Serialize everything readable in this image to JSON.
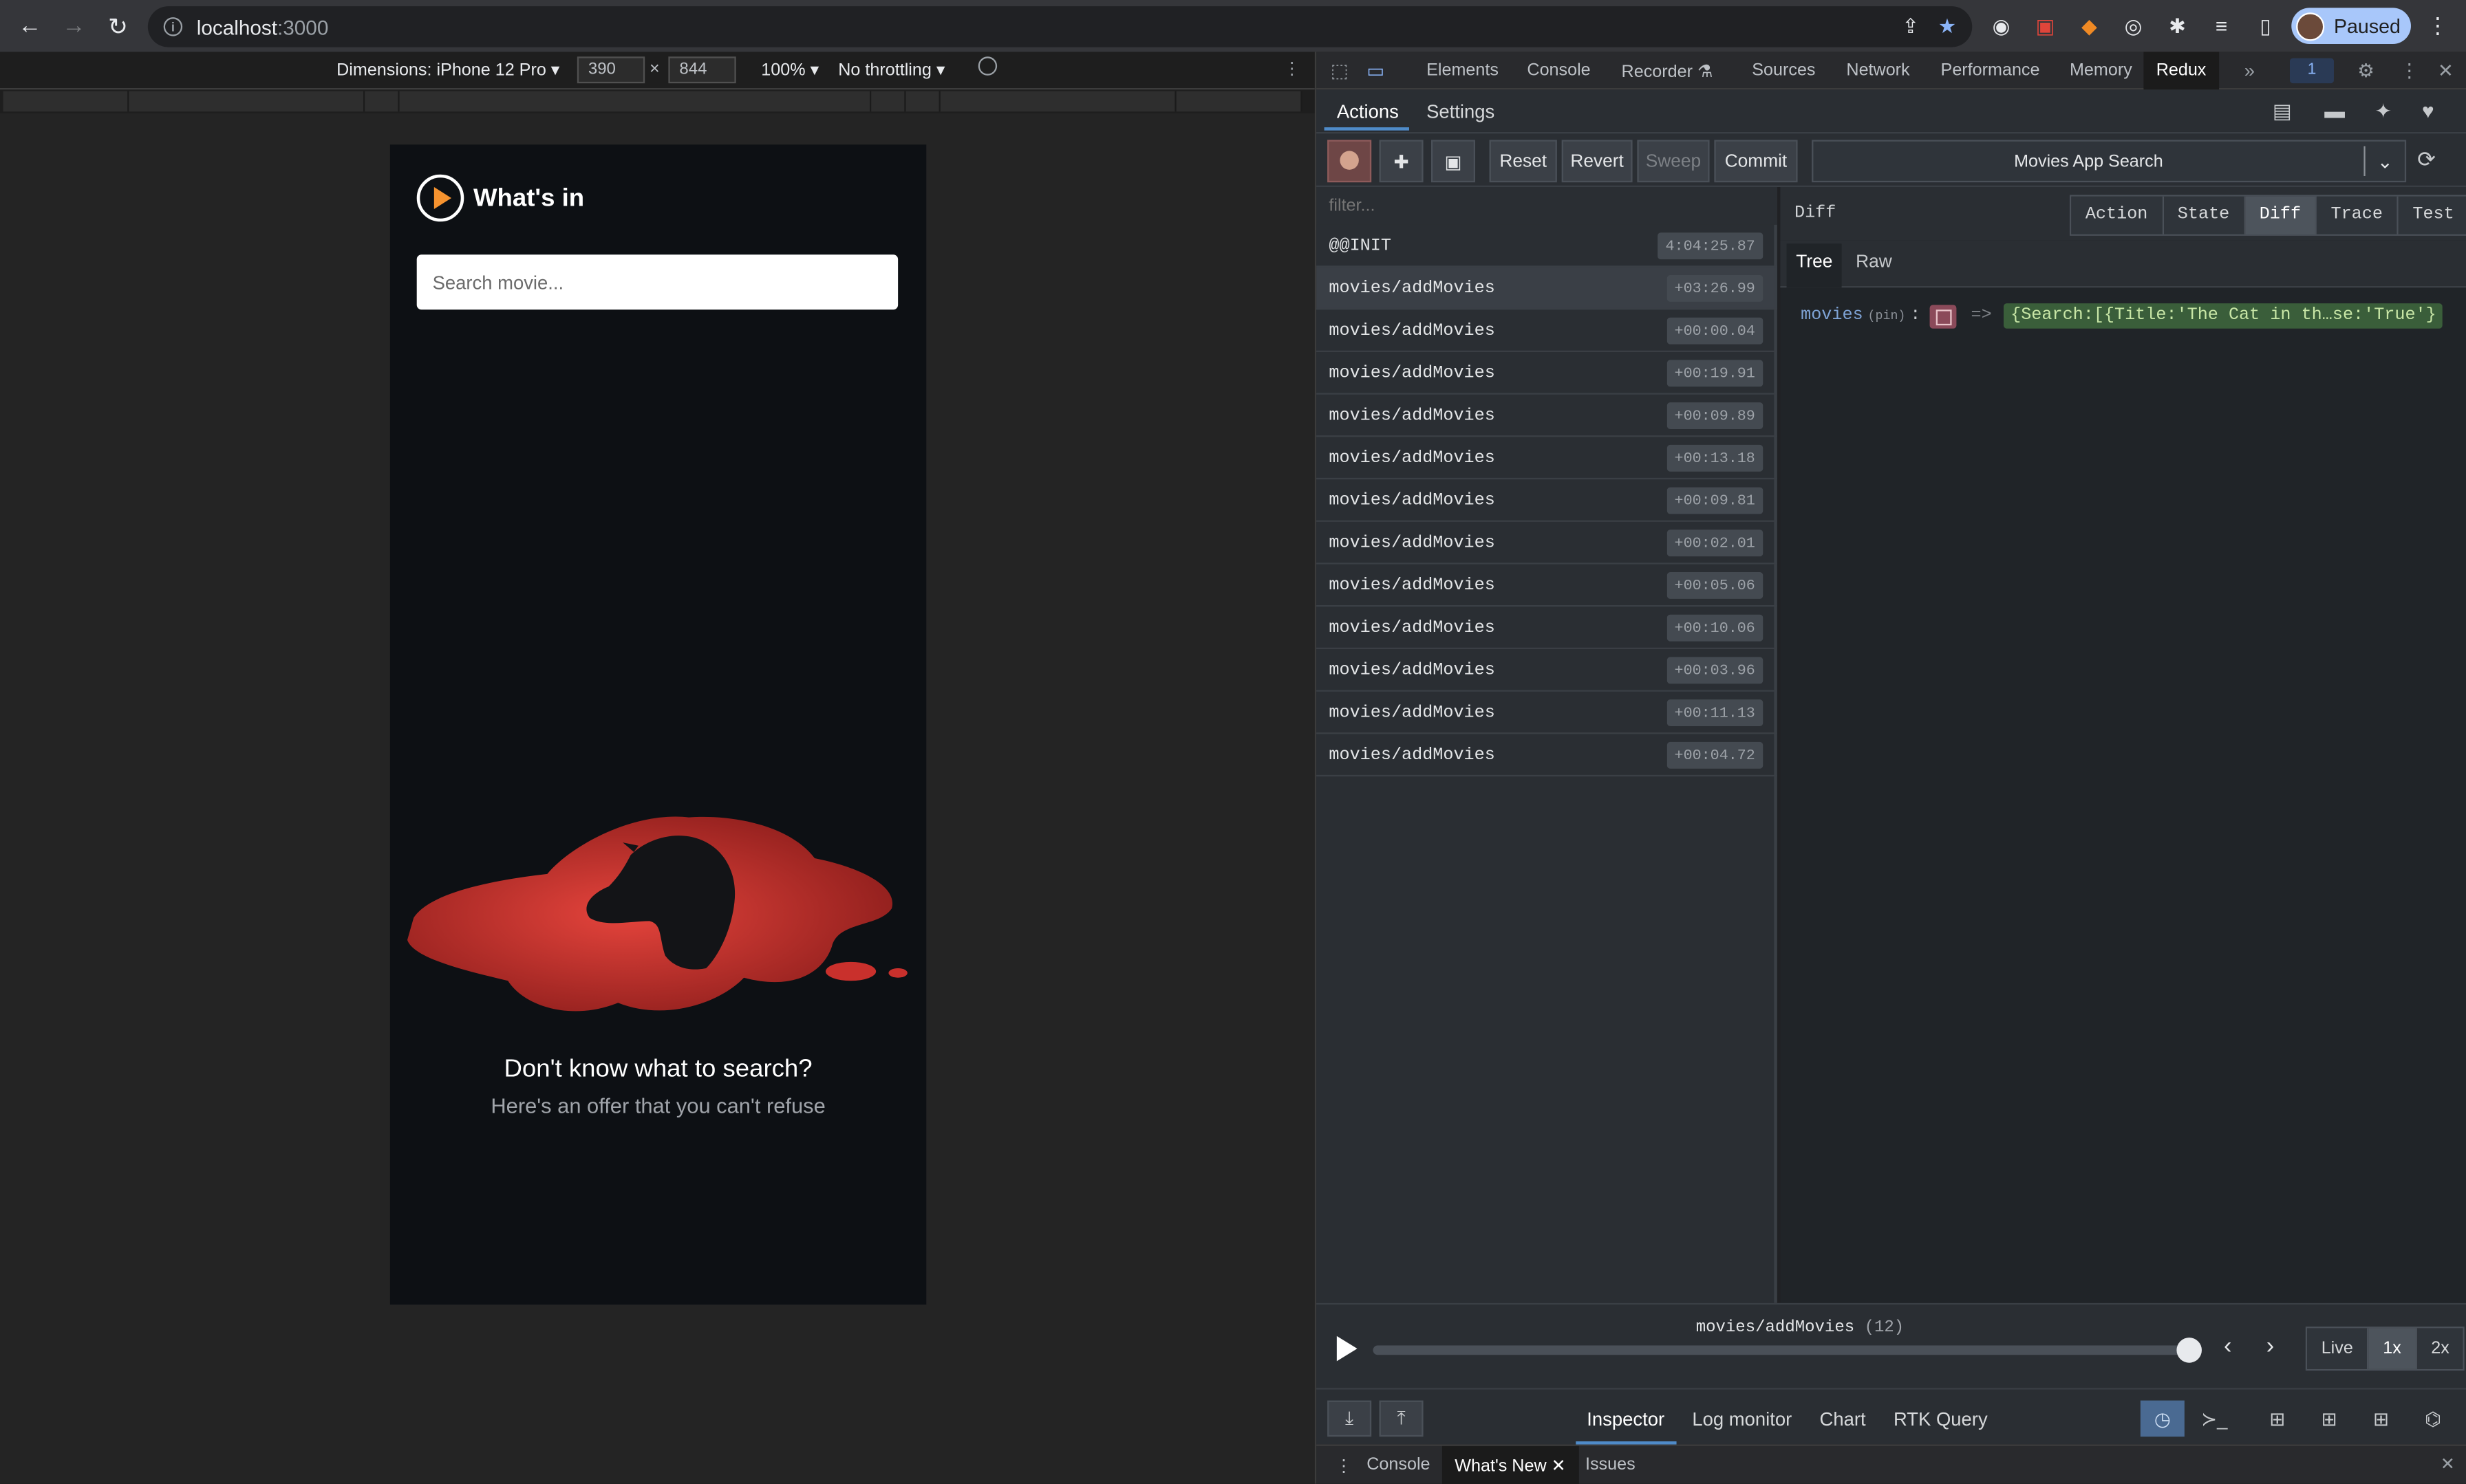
{
  "browser": {
    "url_host": "localhost",
    "url_port": ":3000",
    "profile_label": "Paused"
  },
  "device_toolbar": {
    "dimensions_label": "Dimensions: iPhone 12 Pro ▾",
    "width_value": "390",
    "height_value": "844",
    "times": "×",
    "zoom_label": "100% ▾",
    "throttling_label": "No throttling ▾"
  },
  "app": {
    "title": "What's in",
    "search_placeholder": "Search movie...",
    "empty_title": "Don't know what to search?",
    "empty_subtitle": "Here's an offer that you can't refuse",
    "colors": {
      "accent": "#f6932f",
      "blood": "#c9302c",
      "background": "#0d1014"
    }
  },
  "devtools": {
    "tabs": [
      "Elements",
      "Console",
      "Recorder ⚗",
      "Sources",
      "Network",
      "Performance",
      "Memory",
      "Redux"
    ],
    "active_tab": "Redux",
    "issues_badge": "1",
    "redux": {
      "tabs": [
        "Actions",
        "Settings"
      ],
      "toolbar": {
        "reset": "Reset",
        "revert": "Revert",
        "sweep": "Sweep",
        "commit": "Commit",
        "instance": "Movies App Search"
      },
      "filter_placeholder": "filter...",
      "actions": [
        {
          "name": "@@INIT",
          "time": "4:04:25.87"
        },
        {
          "name": "movies/addMovies",
          "time": "+03:26.99"
        },
        {
          "name": "movies/addMovies",
          "time": "+00:00.04"
        },
        {
          "name": "movies/addMovies",
          "time": "+00:19.91"
        },
        {
          "name": "movies/addMovies",
          "time": "+00:09.89"
        },
        {
          "name": "movies/addMovies",
          "time": "+00:13.18"
        },
        {
          "name": "movies/addMovies",
          "time": "+00:09.81"
        },
        {
          "name": "movies/addMovies",
          "time": "+00:02.01"
        },
        {
          "name": "movies/addMovies",
          "time": "+00:05.06"
        },
        {
          "name": "movies/addMovies",
          "time": "+00:10.06"
        },
        {
          "name": "movies/addMovies",
          "time": "+00:03.96"
        },
        {
          "name": "movies/addMovies",
          "time": "+00:11.13"
        },
        {
          "name": "movies/addMovies",
          "time": "+00:04.72"
        }
      ],
      "inspector": {
        "header": "Diff",
        "modes": [
          "Action",
          "State",
          "Diff",
          "Trace",
          "Test"
        ],
        "active_mode": "Diff",
        "subtabs": [
          "Tree",
          "Raw"
        ],
        "diff_key": "movies",
        "diff_pin": "(pin)",
        "diff_colon": ":",
        "diff_arrow": "=>",
        "diff_value": "{Search:[{Title:'The Cat in th…se:'True'}"
      },
      "slider": {
        "action": "movies/addMovies",
        "count": "(12)",
        "speeds": [
          "Live",
          "1x",
          "2x"
        ],
        "active_speed": "1x"
      },
      "monitors": [
        "Inspector",
        "Log monitor",
        "Chart",
        "RTK Query"
      ],
      "active_monitor": "Inspector"
    },
    "drawer": {
      "tabs": [
        "Console",
        "What's New",
        "Issues"
      ],
      "active": "What's New"
    }
  }
}
